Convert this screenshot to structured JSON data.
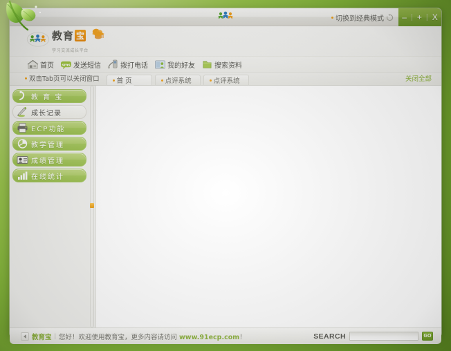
{
  "window": {
    "titlebar": {
      "center_logo_icon": "people-logo-icon",
      "classic_mode_label": "切换到经典模式",
      "refresh_icon": "refresh-icon",
      "minimize_label": "–",
      "maximize_label": "+",
      "close_label": "X"
    }
  },
  "brand": {
    "people_icon": "people-logo-icon",
    "name": "教育",
    "badge": "宝",
    "subtitle": "学习交流成长平台",
    "cap_icon": "graduation-cap-icon"
  },
  "toolbar": {
    "items": [
      {
        "label": "首页",
        "icon": "home-icon"
      },
      {
        "label": "发送短信",
        "icon": "sms-icon"
      },
      {
        "label": "拨打电话",
        "icon": "phone-icon"
      },
      {
        "label": "我的好友",
        "icon": "friends-icon"
      },
      {
        "label": "搜索资料",
        "icon": "search-folder-icon"
      }
    ]
  },
  "tabstrip": {
    "hint": "双击Tab页可以关闭窗口",
    "close_all_label": "关闭全部",
    "tabs": [
      {
        "label": "首 页",
        "active": true
      },
      {
        "label": "点评系统",
        "active": false
      },
      {
        "label": "点评系统",
        "active": false
      }
    ]
  },
  "sidebar": {
    "items": [
      {
        "label": "教 育 宝",
        "icon": "hook-icon",
        "selected": false
      },
      {
        "label": "成长记录",
        "icon": "pencil-icon",
        "selected": true
      },
      {
        "label": "ECP功能",
        "icon": "printer-icon",
        "selected": false
      },
      {
        "label": "教学管理",
        "icon": "pie-chart-icon",
        "selected": false
      },
      {
        "label": "成绩管理",
        "icon": "id-card-icon",
        "selected": false
      },
      {
        "label": "在线统计",
        "icon": "bar-chart-icon",
        "selected": false
      }
    ]
  },
  "splitter": {
    "handle_icon": "collapse-handle-icon"
  },
  "statusbar": {
    "expand_icon": "expand-arrow-icon",
    "brand": "教育宝",
    "separator": "|",
    "message_prefix": "您好！欢迎使用教育宝，更多内容请访问",
    "url": "www.91ecp.com",
    "message_suffix": "！",
    "search_label": "SEARCH",
    "search_value": "",
    "search_placeholder": "",
    "go_label": "GO"
  },
  "colors": {
    "accent_green": "#8fbb3e",
    "accent_orange": "#f0a21b",
    "nav_green": "#a6c85c",
    "text_gray": "#5c5c56"
  }
}
